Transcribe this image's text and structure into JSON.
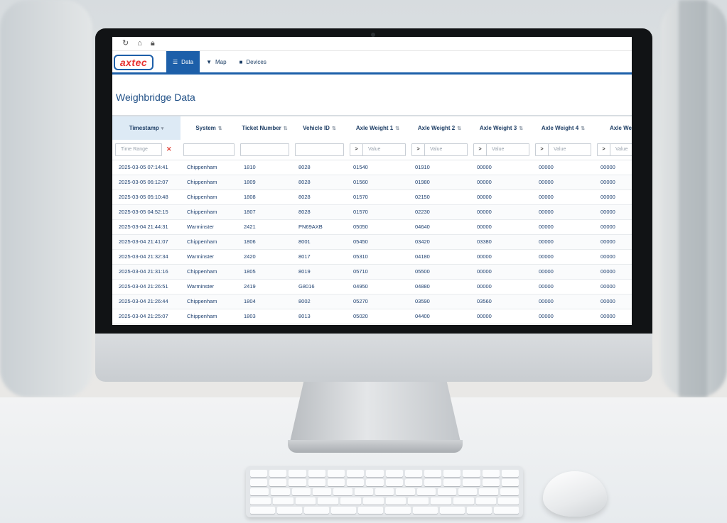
{
  "app": {
    "logo_text": "axtec",
    "tabs": [
      {
        "label": "Data",
        "icon": "table-icon",
        "active": true
      },
      {
        "label": "Map",
        "icon": "map-pin-icon",
        "active": false
      },
      {
        "label": "Devices",
        "icon": "device-icon",
        "active": false
      }
    ],
    "page_title": "Weighbridge Data"
  },
  "browser": {
    "icons": [
      "refresh-icon",
      "home-icon",
      "lock-icon"
    ]
  },
  "table": {
    "columns": [
      "Timestamp",
      "System",
      "Ticket Number",
      "Vehicle ID",
      "Axle Weight 1",
      "Axle Weight 2",
      "Axle Weight 3",
      "Axle Weight 4",
      "Axle Weig"
    ],
    "sort_column": "Timestamp",
    "filters": {
      "time_range_placeholder": "Time Range",
      "operator": ">",
      "value_placeholder": "Value"
    },
    "rows": [
      [
        "2025-03-05 07:14:41",
        "Chippenham",
        "1810",
        "8028",
        "01540",
        "01910",
        "00000",
        "00000",
        "00000"
      ],
      [
        "2025-03-05 06:12:07",
        "Chippenham",
        "1809",
        "8028",
        "01560",
        "01980",
        "00000",
        "00000",
        "00000"
      ],
      [
        "2025-03-05 05:10:48",
        "Chippenham",
        "1808",
        "8028",
        "01570",
        "02150",
        "00000",
        "00000",
        "00000"
      ],
      [
        "2025-03-05 04:52:15",
        "Chippenham",
        "1807",
        "8028",
        "01570",
        "02230",
        "00000",
        "00000",
        "00000"
      ],
      [
        "2025-03-04 21:44:31",
        "Warminster",
        "2421",
        "PN69AXB",
        "05050",
        "04640",
        "00000",
        "00000",
        "00000"
      ],
      [
        "2025-03-04 21:41:07",
        "Chippenham",
        "1806",
        "8001",
        "05450",
        "03420",
        "03380",
        "00000",
        "00000"
      ],
      [
        "2025-03-04 21:32:34",
        "Warminster",
        "2420",
        "8017",
        "05310",
        "04180",
        "00000",
        "00000",
        "00000"
      ],
      [
        "2025-03-04 21:31:16",
        "Chippenham",
        "1805",
        "8019",
        "05710",
        "05500",
        "00000",
        "00000",
        "00000"
      ],
      [
        "2025-03-04 21:26:51",
        "Warminster",
        "2419",
        "G8016",
        "04950",
        "04880",
        "00000",
        "00000",
        "00000"
      ],
      [
        "2025-03-04 21:26:44",
        "Chippenham",
        "1804",
        "8002",
        "05270",
        "03590",
        "03560",
        "00000",
        "00000"
      ],
      [
        "2025-03-04 21:25:07",
        "Chippenham",
        "1803",
        "8013",
        "05020",
        "04400",
        "00000",
        "00000",
        "00000"
      ]
    ]
  }
}
